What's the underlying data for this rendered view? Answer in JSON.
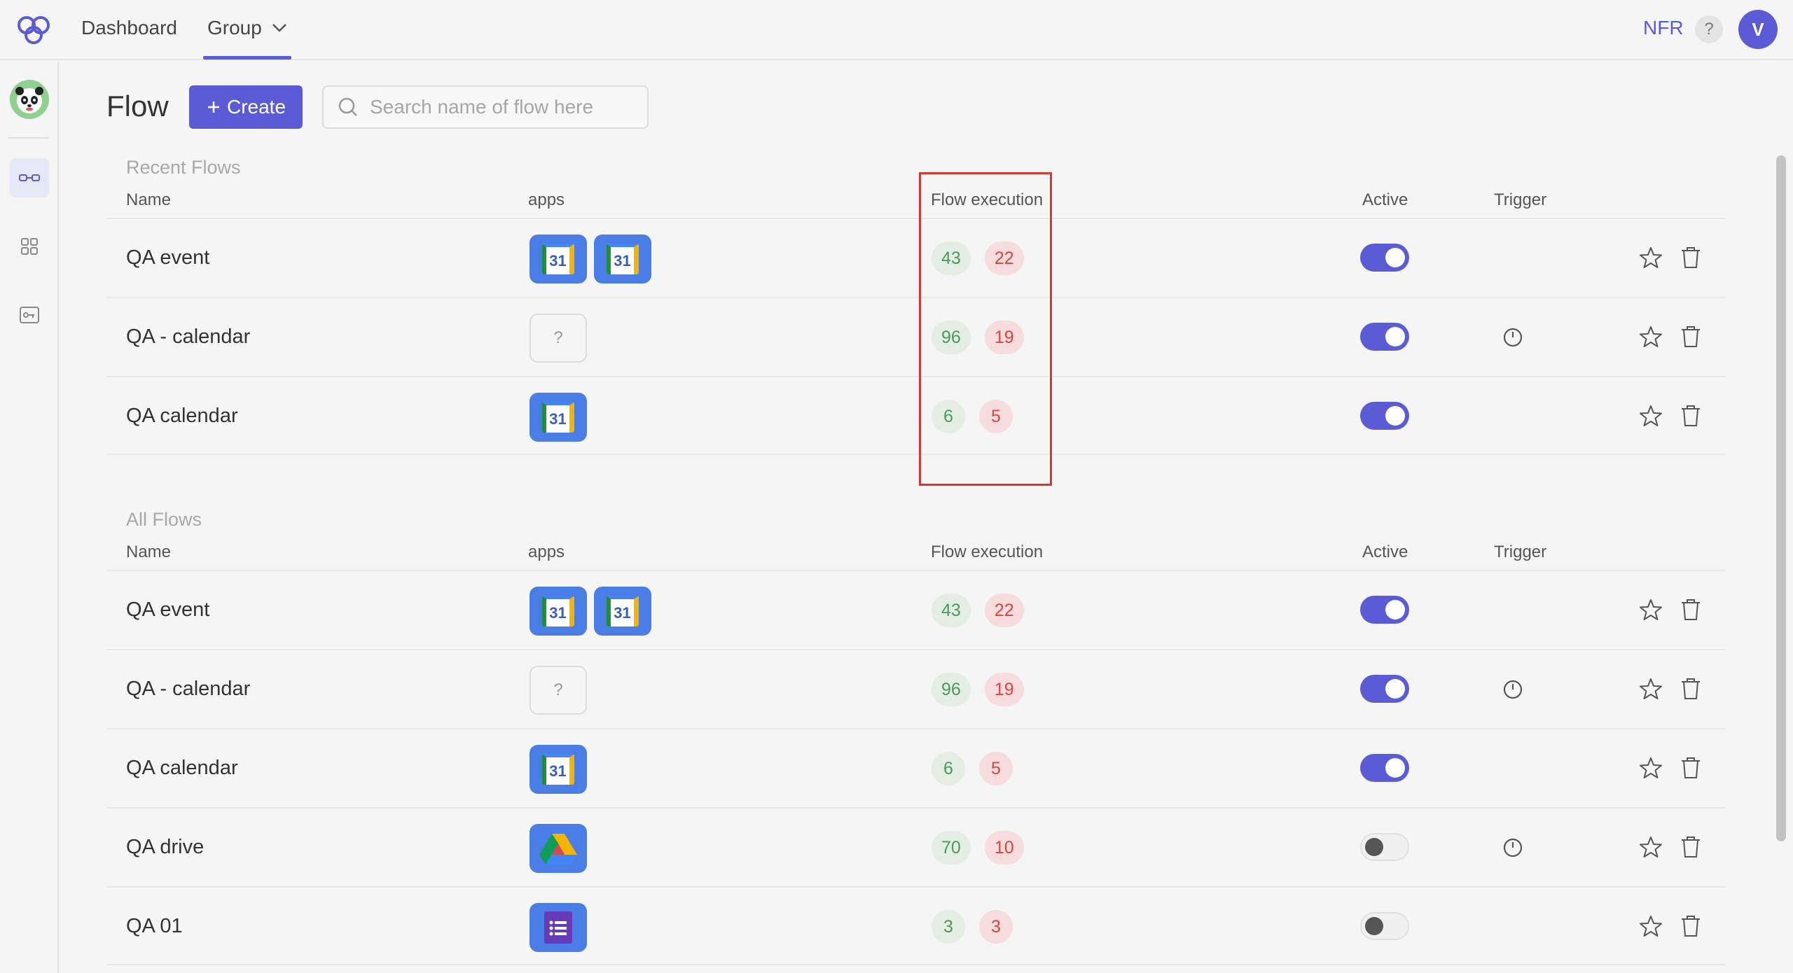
{
  "topbar": {
    "nav": [
      {
        "label": "Dashboard"
      },
      {
        "label": "Group"
      }
    ],
    "nfr": "NFR",
    "help": "?",
    "user_initial": "V"
  },
  "header": {
    "title": "Flow",
    "create_label": "Create",
    "search_placeholder": "Search name of flow here"
  },
  "columns": {
    "name": "Name",
    "apps": "apps",
    "execution": "Flow execution",
    "active": "Active",
    "trigger": "Trigger"
  },
  "recent": {
    "title": "Recent Flows",
    "rows": [
      {
        "name": "QA event",
        "apps": [
          "calendar",
          "calendar"
        ],
        "success": "43",
        "failed": "22",
        "active": true,
        "trigger": false
      },
      {
        "name": "QA - calendar",
        "apps": [
          "unknown"
        ],
        "success": "96",
        "failed": "19",
        "active": true,
        "trigger": true
      },
      {
        "name": "QA calendar",
        "apps": [
          "calendar"
        ],
        "success": "6",
        "failed": "5",
        "active": true,
        "trigger": false
      }
    ]
  },
  "all": {
    "title": "All Flows",
    "rows": [
      {
        "name": "QA event",
        "apps": [
          "calendar",
          "calendar"
        ],
        "success": "43",
        "failed": "22",
        "active": true,
        "trigger": false
      },
      {
        "name": "QA - calendar",
        "apps": [
          "unknown"
        ],
        "success": "96",
        "failed": "19",
        "active": true,
        "trigger": true
      },
      {
        "name": "QA calendar",
        "apps": [
          "calendar"
        ],
        "success": "6",
        "failed": "5",
        "active": true,
        "trigger": false
      },
      {
        "name": "QA drive",
        "apps": [
          "drive"
        ],
        "success": "70",
        "failed": "10",
        "active": false,
        "trigger": true
      },
      {
        "name": "QA 01",
        "apps": [
          "forms"
        ],
        "success": "3",
        "failed": "3",
        "active": false,
        "trigger": false
      }
    ]
  },
  "app_icon_text": {
    "calendar": "31",
    "unknown": "?"
  },
  "colors": {
    "accent": "#5b5bd6",
    "success_bg": "#e3ede4",
    "success_text": "#4a9a5c",
    "error_bg": "#f6dcdc",
    "error_text": "#d9443f",
    "highlight": "#d6372f"
  }
}
